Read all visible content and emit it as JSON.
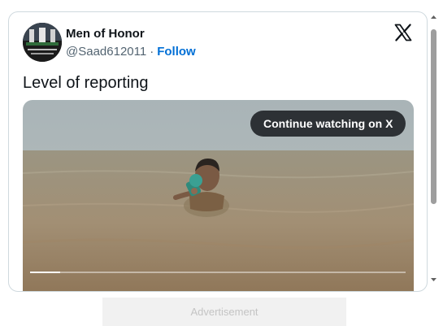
{
  "tweet": {
    "display_name": "Men of Honor",
    "handle": "@Saad612011",
    "separator": "·",
    "follow_label": "Follow",
    "text": "Level of reporting",
    "avatar_icon": "profile-avatar-icon",
    "brand_icon": "x-logo-icon"
  },
  "video": {
    "continue_label": "Continue watching on X",
    "progress": 0.08
  },
  "advertisement": {
    "label": "Advertisement"
  },
  "colors": {
    "follow": "#006fd6",
    "text": "#0f1419",
    "muted": "#536471",
    "border": "#cfd9de",
    "button_bg": "#2d3135"
  }
}
